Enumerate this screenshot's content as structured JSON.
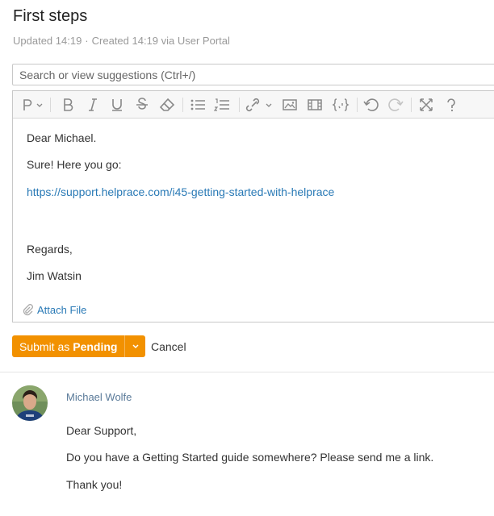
{
  "ticket": {
    "title": "First steps",
    "meta": {
      "updated": "Updated 14:19",
      "separator": "·",
      "created": "Created 14:19 via User Portal"
    }
  },
  "search": {
    "placeholder": "Search or view suggestions (Ctrl+/)"
  },
  "toolbar": {
    "icons": [
      "paragraph-icon",
      "bold-icon",
      "italic-icon",
      "underline-icon",
      "strikethrough-icon",
      "clear-format-icon",
      "bullet-list-icon",
      "numbered-list-icon",
      "link-icon",
      "image-icon",
      "video-icon",
      "code-icon",
      "undo-icon",
      "redo-icon",
      "fullscreen-icon",
      "help-icon"
    ]
  },
  "editor": {
    "greeting": "Dear Michael.",
    "line1": "Sure! Here you go:",
    "link": "https://support.helprace.com/i45-getting-started-with-helprace",
    "closing": "Regards,",
    "signature": "Jim Watsin",
    "attach_label": "Attach File"
  },
  "actions": {
    "submit_prefix": "Submit as",
    "submit_status": "Pending",
    "cancel_label": "Cancel",
    "accent": "#f29100"
  },
  "message": {
    "author": "Michael Wolfe",
    "greeting": "Dear Support,",
    "body": "Do you have a Getting Started guide somewhere? Please send me a link.",
    "closing": "Thank you!"
  }
}
